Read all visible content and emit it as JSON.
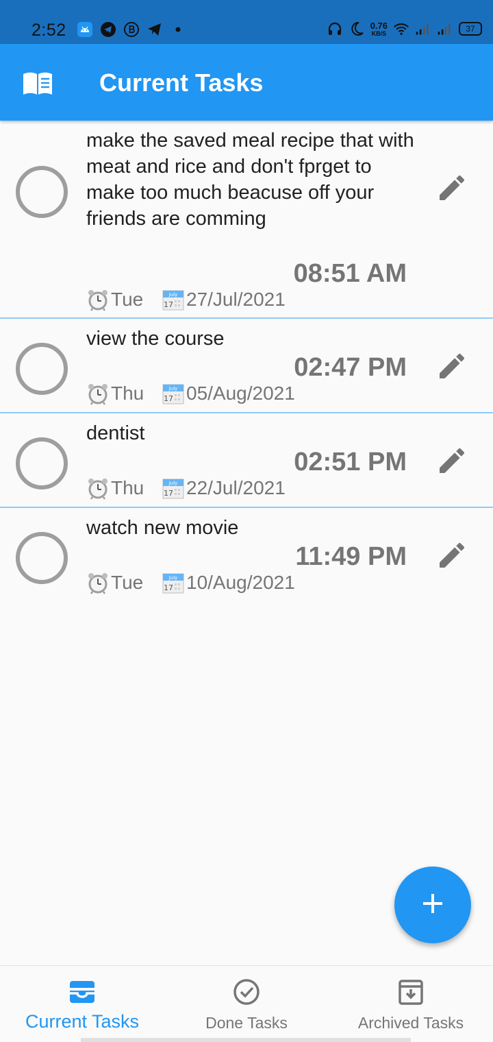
{
  "status_bar": {
    "time": "2:52",
    "net_speed_value": "0.76",
    "net_speed_unit": "KB/S",
    "battery": "37"
  },
  "app_bar": {
    "title": "Current Tasks",
    "icon": "menu-book-icon"
  },
  "tasks": [
    {
      "title": "make the saved meal recipe that with meat and rice and don't fprget to make too much beacuse off your friends are comming",
      "time": "08:51 AM",
      "day": "Tue",
      "date": "27/Jul/2021"
    },
    {
      "title": "view the course",
      "time": "02:47 PM",
      "day": "Thu",
      "date": "05/Aug/2021"
    },
    {
      "title": "dentist",
      "time": "02:51 PM",
      "day": "Thu",
      "date": "22/Jul/2021"
    },
    {
      "title": "watch new movie",
      "time": "11:49 PM",
      "day": "Tue",
      "date": "10/Aug/2021"
    }
  ],
  "calendar_emoji": {
    "month": "July",
    "day": "17"
  },
  "fab": {
    "icon": "plus-icon"
  },
  "bottom_nav": {
    "items": [
      {
        "label": "Current Tasks",
        "icon": "inbox-icon",
        "active": true
      },
      {
        "label": "Done Tasks",
        "icon": "check-circle-icon",
        "active": false
      },
      {
        "label": "Archived Tasks",
        "icon": "archive-icon",
        "active": false
      }
    ]
  },
  "colors": {
    "primary": "#2196f3",
    "status_bar": "#1a6fbd",
    "divider": "#90caf9",
    "muted": "#757575",
    "circle": "#9e9e9e"
  }
}
